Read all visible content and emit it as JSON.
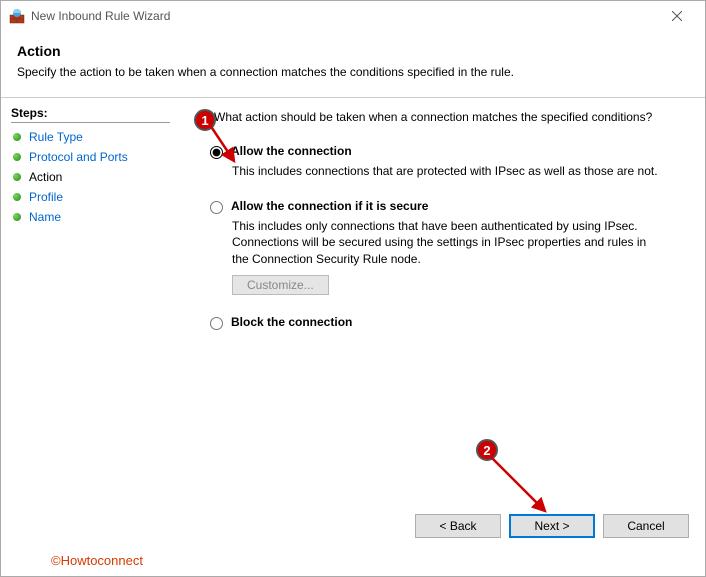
{
  "window": {
    "title": "New Inbound Rule Wizard"
  },
  "header": {
    "title": "Action",
    "subtitle": "Specify the action to be taken when a connection matches the conditions specified in the rule."
  },
  "sidebar": {
    "title": "Steps:",
    "items": [
      {
        "label": "Rule Type",
        "state": "link"
      },
      {
        "label": "Protocol and Ports",
        "state": "link"
      },
      {
        "label": "Action",
        "state": "current"
      },
      {
        "label": "Profile",
        "state": "link"
      },
      {
        "label": "Name",
        "state": "link"
      }
    ]
  },
  "content": {
    "prompt": "What action should be taken when a connection matches the specified conditions?",
    "options": [
      {
        "label": "Allow the connection",
        "desc": "This includes connections that are protected with IPsec as well as those are not.",
        "selected": true
      },
      {
        "label": "Allow the connection if it is secure",
        "desc": "This includes only connections that have been authenticated by using IPsec.  Connections will be secured using the settings in IPsec properties and rules in the Connection Security Rule node.",
        "selected": false,
        "customize": "Customize..."
      },
      {
        "label": "Block the connection",
        "desc": "",
        "selected": false
      }
    ]
  },
  "footer": {
    "back": "< Back",
    "next": "Next >",
    "cancel": "Cancel"
  },
  "watermark": "©Howtoconnect",
  "annotations": {
    "marker1": "1",
    "marker2": "2"
  }
}
